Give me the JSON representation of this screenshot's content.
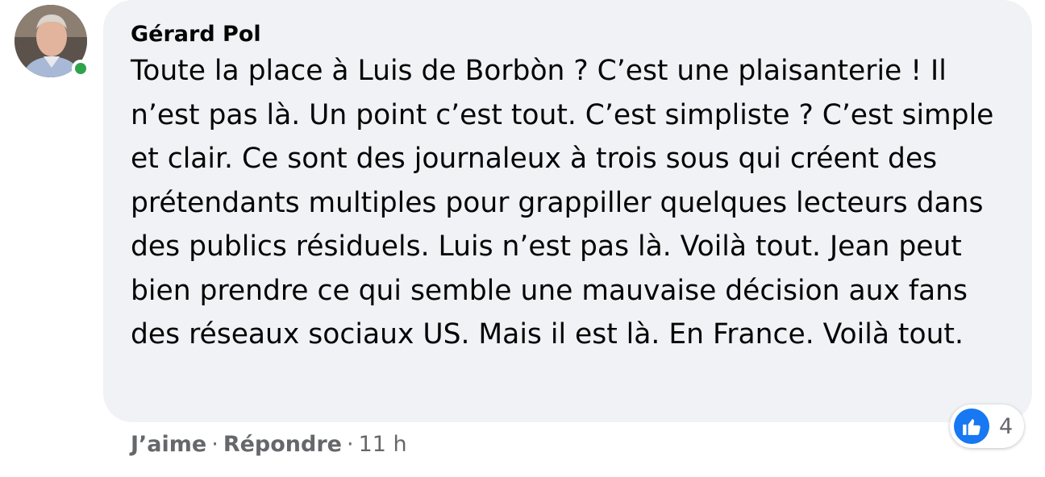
{
  "comment": {
    "author": "Gérard Pol",
    "text": "Toute la place à Luis de Borbòn ? C’est une plaisanterie ! Il n’est pas là. Un point c’est tout. C’est simpliste ? C’est simple et clair. Ce sont des journaleux à trois sous qui créent des prétendants multiples pour grappiller quelques lecteurs dans des publics résiduels. Luis n’est pas là. Voilà tout. Jean peut bien prendre ce qui semble une mauvaise décision aux fans des réseaux sociaux US. Mais il est là. En France. Voilà tout.",
    "online_status_color": "#31a24c"
  },
  "reactions": {
    "icon": "like-thumbs-up-icon",
    "count": "4",
    "color": "#1877f2"
  },
  "actions": {
    "like_label": "J’aime",
    "separator": "·",
    "reply_label": "Répondre",
    "timestamp": "11 h"
  }
}
